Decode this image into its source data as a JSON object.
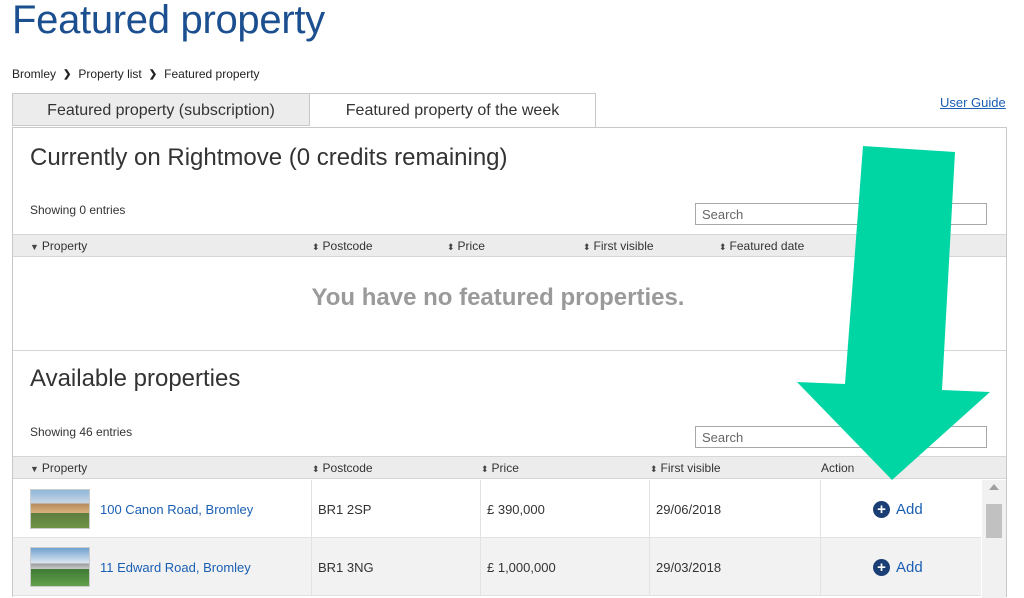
{
  "page": {
    "title": "Featured property"
  },
  "breadcrumb": [
    "Bromley",
    "Property list",
    "Featured property"
  ],
  "user_guide": "User Guide",
  "tabs": [
    {
      "label": "Featured property (subscription)",
      "active": false
    },
    {
      "label": "Featured property of the week",
      "active": true
    }
  ],
  "current": {
    "title": "Currently on Rightmove (0 credits remaining)",
    "showing": "Showing 0 entries",
    "search_placeholder": "Search",
    "columns": [
      "Property",
      "Postcode",
      "Price",
      "First visible",
      "Featured date"
    ],
    "empty_message": "You have no featured properties."
  },
  "available": {
    "title": "Available properties",
    "showing": "Showing 46 entries",
    "search_placeholder": "Search",
    "columns": [
      "Property",
      "Postcode",
      "Price",
      "First visible",
      "Action"
    ],
    "rows": [
      {
        "address": "100 Canon Road, Bromley",
        "postcode": "BR1 2SP",
        "price": "£ 390,000",
        "first_visible": "29/06/2018",
        "action": "Add"
      },
      {
        "address": "11 Edward Road, Bromley",
        "postcode": "BR1 3NG",
        "price": "£ 1,000,000",
        "first_visible": "29/03/2018",
        "action": "Add"
      }
    ]
  },
  "colors": {
    "title_blue": "#1b4f8f",
    "link_blue": "#1a5fb4",
    "arrow": "#00d6a4",
    "header_bg": "#ececec"
  }
}
